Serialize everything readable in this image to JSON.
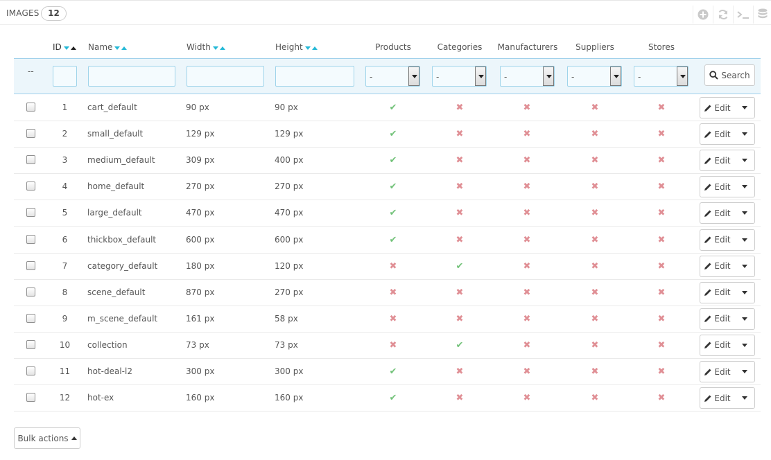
{
  "panel": {
    "title": "IMAGES",
    "count": "12"
  },
  "toolbar": {
    "icons": [
      "add-icon",
      "refresh-icon",
      "sql-query-icon",
      "database-icon"
    ]
  },
  "columns": {
    "id": "ID",
    "name": "Name",
    "width": "Width",
    "height": "Height",
    "products": "Products",
    "categories": "Categories",
    "manufacturers": "Manufacturers",
    "suppliers": "Suppliers",
    "stores": "Stores"
  },
  "filters": {
    "dash": "--",
    "select_default": "-",
    "search_label": "Search"
  },
  "rows": [
    {
      "id": "1",
      "name": "cart_default",
      "width": "90 px",
      "height": "90 px",
      "products": true,
      "categories": false,
      "manufacturers": false,
      "suppliers": false,
      "stores": false
    },
    {
      "id": "2",
      "name": "small_default",
      "width": "129 px",
      "height": "129 px",
      "products": true,
      "categories": false,
      "manufacturers": false,
      "suppliers": false,
      "stores": false
    },
    {
      "id": "3",
      "name": "medium_default",
      "width": "309 px",
      "height": "400 px",
      "products": true,
      "categories": false,
      "manufacturers": false,
      "suppliers": false,
      "stores": false
    },
    {
      "id": "4",
      "name": "home_default",
      "width": "270 px",
      "height": "270 px",
      "products": true,
      "categories": false,
      "manufacturers": false,
      "suppliers": false,
      "stores": false
    },
    {
      "id": "5",
      "name": "large_default",
      "width": "470 px",
      "height": "470 px",
      "products": true,
      "categories": false,
      "manufacturers": false,
      "suppliers": false,
      "stores": false
    },
    {
      "id": "6",
      "name": "thickbox_default",
      "width": "600 px",
      "height": "600 px",
      "products": true,
      "categories": false,
      "manufacturers": false,
      "suppliers": false,
      "stores": false
    },
    {
      "id": "7",
      "name": "category_default",
      "width": "180 px",
      "height": "120 px",
      "products": false,
      "categories": true,
      "manufacturers": false,
      "suppliers": false,
      "stores": false
    },
    {
      "id": "8",
      "name": "scene_default",
      "width": "870 px",
      "height": "270 px",
      "products": false,
      "categories": false,
      "manufacturers": false,
      "suppliers": false,
      "stores": false
    },
    {
      "id": "9",
      "name": "m_scene_default",
      "width": "161 px",
      "height": "58 px",
      "products": false,
      "categories": false,
      "manufacturers": false,
      "suppliers": false,
      "stores": false
    },
    {
      "id": "10",
      "name": "collection",
      "width": "73 px",
      "height": "73 px",
      "products": false,
      "categories": true,
      "manufacturers": false,
      "suppliers": false,
      "stores": false
    },
    {
      "id": "11",
      "name": "hot-deal-l2",
      "width": "300 px",
      "height": "300 px",
      "products": true,
      "categories": false,
      "manufacturers": false,
      "suppliers": false,
      "stores": false
    },
    {
      "id": "12",
      "name": "hot-ex",
      "width": "160 px",
      "height": "160 px",
      "products": true,
      "categories": false,
      "manufacturers": false,
      "suppliers": false,
      "stores": false
    }
  ],
  "row_actions": {
    "edit_label": "Edit"
  },
  "bulk": {
    "label": "Bulk actions"
  },
  "colors": {
    "check": "#72c279",
    "cross": "#e08f95",
    "accent": "#25b9d7"
  }
}
